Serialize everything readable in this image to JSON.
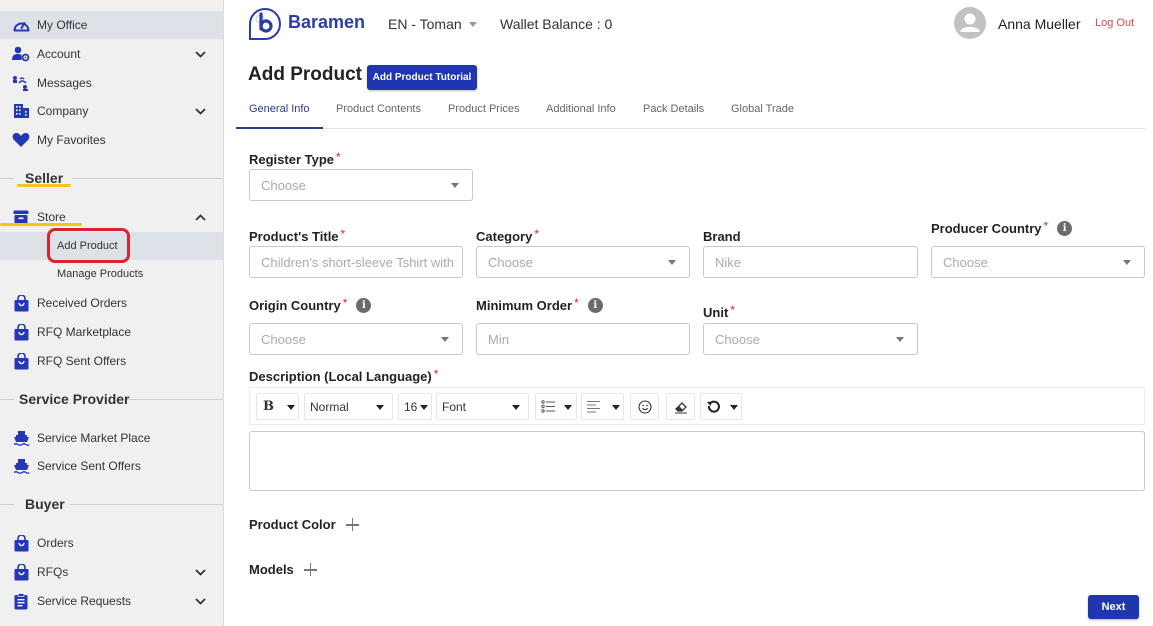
{
  "sidebar": {
    "top_items": [
      {
        "label": "My Office",
        "icon": "speedometer-icon",
        "active": true
      },
      {
        "label": "Account",
        "icon": "user-gear-icon",
        "has_chevron": true
      },
      {
        "label": "Messages",
        "icon": "messages-icon"
      },
      {
        "label": "Company",
        "icon": "building-icon",
        "has_chevron": true
      },
      {
        "label": "My Favorites",
        "icon": "heart-icon"
      }
    ],
    "sections": {
      "seller": "Seller",
      "service_provider": "Service Provider",
      "buyer": "Buyer"
    },
    "seller_items": {
      "store": {
        "label": "Store",
        "icon": "archive-box-icon",
        "expanded": true
      },
      "sub_items": [
        {
          "label": "Add Product",
          "active": true
        },
        {
          "label": "Manage Products"
        }
      ],
      "others": [
        {
          "label": "Received Orders",
          "icon": "shopping-bag-icon"
        },
        {
          "label": "RFQ Marketplace",
          "icon": "shopping-bag-icon"
        },
        {
          "label": "RFQ Sent Offers",
          "icon": "shopping-bag-icon"
        }
      ]
    },
    "service_provider_items": [
      {
        "label": "Service Market Place",
        "icon": "ship-icon"
      },
      {
        "label": "Service Sent Offers",
        "icon": "ship-icon"
      }
    ],
    "buyer_items": [
      {
        "label": "Orders",
        "icon": "shopping-bag-icon"
      },
      {
        "label": "RFQs",
        "icon": "shopping-bag-icon",
        "has_chevron": true
      },
      {
        "label": "Service Requests",
        "icon": "clipboard-icon",
        "has_chevron": true
      }
    ]
  },
  "header": {
    "brand": "Baramen",
    "language_currency": "EN - Toman",
    "wallet_balance": "Wallet Balance : 0",
    "user_name": "Anna Mueller",
    "logout_label": "Log Out"
  },
  "page": {
    "title": "Add Product",
    "tutorial_button": "Add Product Tutorial",
    "tabs": [
      "General Info",
      "Product Contents",
      "Product Prices",
      "Additional Info",
      "Pack Details",
      "Global Trade"
    ],
    "active_tab": "General Info"
  },
  "form": {
    "register_type": {
      "label": "Register Type",
      "required": true,
      "placeholder": "Choose"
    },
    "product_title": {
      "label": "Product's Title",
      "required": true,
      "placeholder": "Children's short-sleeve Tshirt with",
      "value": ""
    },
    "category": {
      "label": "Category",
      "required": true,
      "placeholder": "Choose"
    },
    "brand": {
      "label": "Brand",
      "required": false,
      "placeholder": "Nike",
      "value": ""
    },
    "producer_country": {
      "label": "Producer Country",
      "required": true,
      "placeholder": "Choose"
    },
    "origin_country": {
      "label": "Origin Country",
      "required": true,
      "placeholder": "Choose"
    },
    "minimum_order": {
      "label": "Minimum Order",
      "required": true,
      "placeholder": "Min",
      "value": ""
    },
    "unit": {
      "label": "Unit",
      "required": true,
      "placeholder": "Choose"
    },
    "description": {
      "label": "Description (Local Language)",
      "required": true,
      "value": ""
    },
    "required_mark": "*",
    "info_glyph": "i",
    "editor_toolbar": {
      "bold": "B",
      "paragraph_style": "Normal",
      "font_size": "16",
      "font_family": "Font"
    },
    "product_color": "Product Color",
    "models": "Models"
  },
  "footer": {
    "next_button": "Next"
  },
  "colors": {
    "primary": "#1f36b0",
    "brand_text": "#2b3ea8",
    "required": "#d9232d",
    "logout": "#d14b55",
    "sidebar_bg": "#f0f0f0",
    "highlight_yellow": "#f5c518",
    "highlight_red": "#d9232d"
  }
}
